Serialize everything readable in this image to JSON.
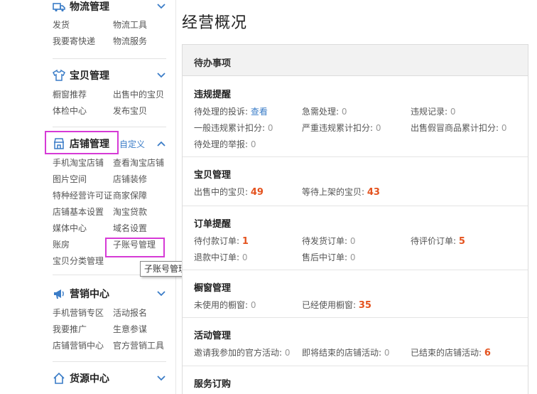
{
  "sidebar": {
    "logistics": {
      "title": "物流管理",
      "icon": "truck-icon",
      "links": [
        "发货",
        "物流工具",
        "我要寄快递",
        "物流服务"
      ]
    },
    "items_mgmt": {
      "title": "宝贝管理",
      "icon": "shirt-icon",
      "links": [
        "橱窗推荐",
        "出售中的宝贝",
        "体检中心",
        "发布宝贝"
      ]
    },
    "shop_mgmt": {
      "title": "店铺管理",
      "icon": "shop-icon",
      "custom": "自定义",
      "links": [
        "手机淘宝店铺",
        "查看淘宝店铺",
        "图片空间",
        "店铺装修",
        "特种经营许可证",
        "商家保障",
        "店铺基本设置",
        "淘宝贷款",
        "媒体中心",
        "域名设置",
        "账房",
        "子账号管理",
        "宝贝分类管理"
      ]
    },
    "marketing": {
      "title": "营销中心",
      "icon": "megaphone-icon",
      "links": [
        "手机营销专区",
        "活动报名",
        "我要推广",
        "生意参谋",
        "店铺营销中心",
        "官方营销工具"
      ]
    },
    "source": {
      "title": "货源中心",
      "icon": "house-icon"
    },
    "tooltip": "子账号管理"
  },
  "main": {
    "title": "经营概况",
    "panel_title": "待办事项",
    "violation": {
      "title": "违规提醒",
      "complaints_label": "待处理的投诉:",
      "complaints_link": "查看",
      "urgent_label": "急需处理:",
      "urgent_value": "0",
      "record_label": "违规记录:",
      "record_value": "0",
      "general_label": "一般违规累计扣分:",
      "general_value": "0",
      "serious_label": "严重违规累计扣分:",
      "serious_value": "0",
      "fake_label": "出售假冒商品累计扣分:",
      "fake_value": "0",
      "report_label": "待处理的举报:",
      "report_value": "0"
    },
    "items": {
      "title": "宝贝管理",
      "on_sale_label": "出售中的宝贝:",
      "on_sale_value": "49",
      "waiting_label": "等待上架的宝贝:",
      "waiting_value": "43"
    },
    "orders": {
      "title": "订单提醒",
      "unpaid_label": "待付款订单:",
      "unpaid_value": "1",
      "unshipped_label": "待发货订单:",
      "unshipped_value": "0",
      "unrated_label": "待评价订单:",
      "unrated_value": "5",
      "refund_label": "退款中订单:",
      "refund_value": "0",
      "aftersale_label": "售后中订单:",
      "aftersale_value": "0"
    },
    "showcase": {
      "title": "橱窗管理",
      "unused_label": "未使用的橱窗:",
      "unused_value": "0",
      "used_label": "已经使用橱窗:",
      "used_value": "35"
    },
    "activity": {
      "title": "活动管理",
      "invite_label": "邀请我参加的官方活动:",
      "invite_value": "0",
      "ending_label": "即将结束的店铺活动:",
      "ending_value": "0",
      "ended_label": "已结束的店铺活动:",
      "ended_value": "6"
    },
    "service": {
      "title": "服务订购"
    }
  },
  "colors": {
    "accent": "#3a7cc7",
    "highlight_value": "#e4531f",
    "annotation": "#d63ad6"
  }
}
